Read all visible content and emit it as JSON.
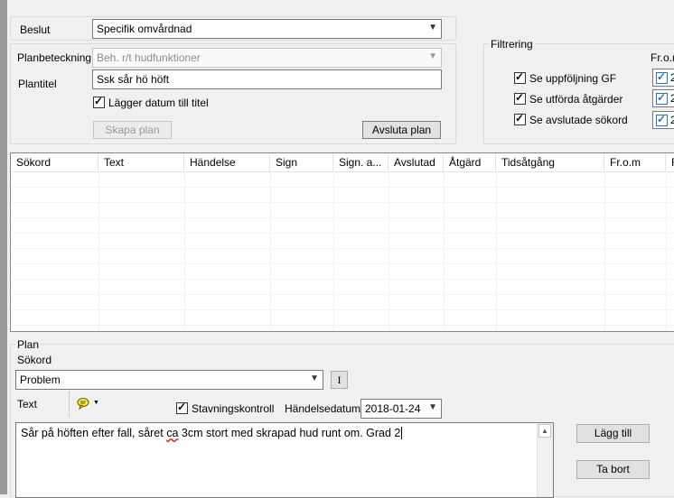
{
  "beslut": {
    "label": "Beslut",
    "value": "Specifik omvårdnad"
  },
  "planbeteckning": {
    "label": "Planbeteckning",
    "value": "Beh. r/t hudfunktioner"
  },
  "plantitel": {
    "label": "Plantitel",
    "value": "Ssk sår hö höft"
  },
  "datum_checkbox": {
    "label": "Lägger datum till titel",
    "checked": true
  },
  "buttons": {
    "skapa_plan": "Skapa plan",
    "avsluta_plan": "Avsluta plan",
    "lagg_till": "Lägg till",
    "ta_bort": "Ta bort",
    "format": "I"
  },
  "filtrering": {
    "title": "Filtrering",
    "from_label": "Fr.o.m",
    "items": [
      {
        "label": "Se uppföljning GF",
        "checked": true
      },
      {
        "label": "Se utförda åtgärder",
        "checked": true
      },
      {
        "label": "Se avslutade sökord",
        "checked": true
      }
    ],
    "right_checks": [
      "2",
      "2",
      "2"
    ]
  },
  "grid": {
    "columns": [
      "Sökord",
      "Text",
      "Händelse",
      "Sign",
      "Sign. a...",
      "Avslutad",
      "Åtgärd",
      "Tidsåtgång",
      "Fr.o.m",
      "F"
    ]
  },
  "plan": {
    "title": "Plan",
    "sokord_label": "Sökord",
    "sokord_value": "Problem",
    "text_label": "Text",
    "stavning_label": "Stavningskontroll",
    "stavning_checked": true,
    "handelsedatum_label": "Händelsedatum",
    "handelsedatum_value": "2018-01-24",
    "text_value_before": "Sår på höften efter fall, såret ",
    "text_value_underlined": "ca",
    "text_value_after": " 3cm stort med skrapad hud runt om. Grad 2"
  },
  "icons": {
    "comment_icon": "speech-bubble-icon",
    "dropdown": "chevron-down-icon"
  }
}
